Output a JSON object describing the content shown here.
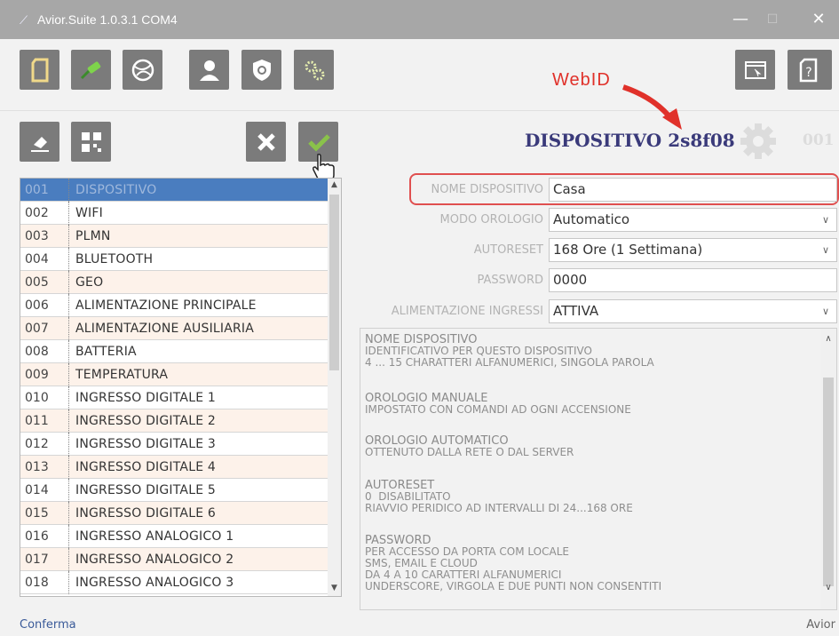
{
  "window": {
    "title": "Avior.Suite 1.0.3.1  COM4",
    "controls": {
      "minimize": "—",
      "maximize": "☐",
      "close": "✕"
    }
  },
  "toolbar_top": [
    {
      "icon": "document-icon",
      "color": "#f0d98a"
    },
    {
      "icon": "usb-cable-icon",
      "color": "#7ed44b"
    },
    {
      "icon": "globe-network-icon",
      "color": "#ffffff"
    },
    {
      "icon": "user-icon",
      "color": "#ffffff"
    },
    {
      "icon": "shield-icon",
      "color": "#ffffff"
    },
    {
      "icon": "settings-gears-icon",
      "color": "#e8f0b0"
    }
  ],
  "toolbar_right": [
    {
      "icon": "window-cursor-icon"
    },
    {
      "icon": "help-document-icon"
    }
  ],
  "toolbar_secondary": [
    {
      "icon": "eraser-icon"
    },
    {
      "icon": "qr-code-icon"
    },
    {
      "icon": "cancel-x-icon"
    },
    {
      "icon": "confirm-check-icon",
      "color": "#8ac24a"
    }
  ],
  "annotation": {
    "webid_label": "WebID",
    "color": "#e0312a"
  },
  "device": {
    "title": "DISPOSITIVO 2s8f08",
    "number": "001"
  },
  "list": {
    "selected_index": 0,
    "items": [
      {
        "num": "001",
        "label": "DISPOSITIVO"
      },
      {
        "num": "002",
        "label": "WIFI"
      },
      {
        "num": "003",
        "label": "PLMN"
      },
      {
        "num": "004",
        "label": "BLUETOOTH"
      },
      {
        "num": "005",
        "label": "GEO"
      },
      {
        "num": "006",
        "label": "ALIMENTAZIONE PRINCIPALE"
      },
      {
        "num": "007",
        "label": "ALIMENTAZIONE AUSILIARIA"
      },
      {
        "num": "008",
        "label": "BATTERIA"
      },
      {
        "num": "009",
        "label": "TEMPERATURA"
      },
      {
        "num": "010",
        "label": "INGRESSO DIGITALE 1"
      },
      {
        "num": "011",
        "label": "INGRESSO DIGITALE 2"
      },
      {
        "num": "012",
        "label": "INGRESSO DIGITALE 3"
      },
      {
        "num": "013",
        "label": "INGRESSO DIGITALE 4"
      },
      {
        "num": "014",
        "label": "INGRESSO DIGITALE 5"
      },
      {
        "num": "015",
        "label": "INGRESSO DIGITALE 6"
      },
      {
        "num": "016",
        "label": "INGRESSO ANALOGICO 1"
      },
      {
        "num": "017",
        "label": "INGRESSO ANALOGICO 2"
      },
      {
        "num": "018",
        "label": "INGRESSO ANALOGICO 3"
      }
    ]
  },
  "form": {
    "fields": [
      {
        "label": "NOME DISPOSITIVO",
        "value": "Casa",
        "type": "text"
      },
      {
        "label": "MODO OROLOGIO",
        "value": "Automatico",
        "type": "select"
      },
      {
        "label": "AUTORESET",
        "value": "168 Ore (1 Settimana)",
        "type": "select"
      },
      {
        "label": "PASSWORD",
        "value": "0000",
        "type": "text"
      },
      {
        "label": "ALIMENTAZIONE INGRESSI",
        "value": "ATTIVA",
        "type": "select"
      }
    ]
  },
  "help": {
    "paragraphs": [
      {
        "heading": "NOME DISPOSITIVO",
        "lines": [
          "IDENTIFICATIVO PER QUESTO DISPOSITIVO",
          "4 ... 15 CHARATTERI ALFANUMERICI, SINGOLA PAROLA"
        ]
      },
      {
        "heading": "OROLOGIO MANUALE",
        "lines": [
          "IMPOSTATO CON COMANDI AD OGNI ACCENSIONE"
        ]
      },
      {
        "heading": "OROLOGIO AUTOMATICO",
        "lines": [
          "OTTENUTO DALLA RETE O DAL SERVER"
        ]
      },
      {
        "heading": "AUTORESET",
        "lines": [
          "0  DISABILITATO",
          "RIAVVIO PERIDICO AD INTERVALLI DI 24...168 ORE"
        ]
      },
      {
        "heading": "PASSWORD",
        "lines": [
          "PER ACCESSO DA PORTA COM LOCALE",
          "SMS, EMAIL E CLOUD",
          "DA 4 A 10 CARATTERI ALFANUMERICI",
          "UNDERSCORE, VIRGOLA E DUE PUNTI NON CONSENTITI"
        ]
      }
    ]
  },
  "status": {
    "left": "Conferma",
    "right": "Avior"
  }
}
